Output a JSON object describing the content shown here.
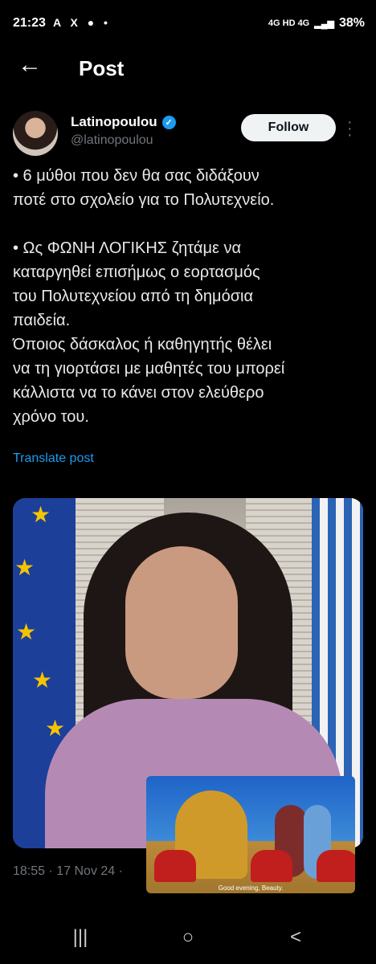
{
  "status_bar": {
    "time": "21:23",
    "notification_icons": "A X ● •",
    "network": "4G  HD 4G",
    "battery": "38%"
  },
  "header": {
    "title": "Post"
  },
  "author": {
    "name": "Latinopoulou",
    "handle": "@latinopoulou",
    "follow_label": "Follow",
    "verified_color": "#1d9bf0"
  },
  "tweet": {
    "lines": [
      "• 6 μύθοι που δεν θα σας διδάξουν",
      "ποτέ στο σχολείο για το Πολυτεχνείο.",
      "",
      "• Ως ΦΩΝΗ ΛΟΓΙΚΗΣ ζητάμε να",
      "καταργηθεί επισήμως ο εορτασμός",
      "του Πολυτεχνείου από τη δημόσια",
      "παιδεία.",
      "Όποιος δάσκαλος ή καθηγητής θέλει",
      "να τη γιορτάσει με μαθητές του μπορεί",
      "κάλλιστα να το κάνει στον ελεύθερο",
      "χρόνο του."
    ],
    "translate_label": "Translate post"
  },
  "pip": {
    "caption": "Good evening, Beauty."
  },
  "meta": {
    "timestamp": "18:55 · 17 Nov 24 ·"
  },
  "navbar": {
    "recents": "|||",
    "home": "○",
    "back": "<"
  }
}
